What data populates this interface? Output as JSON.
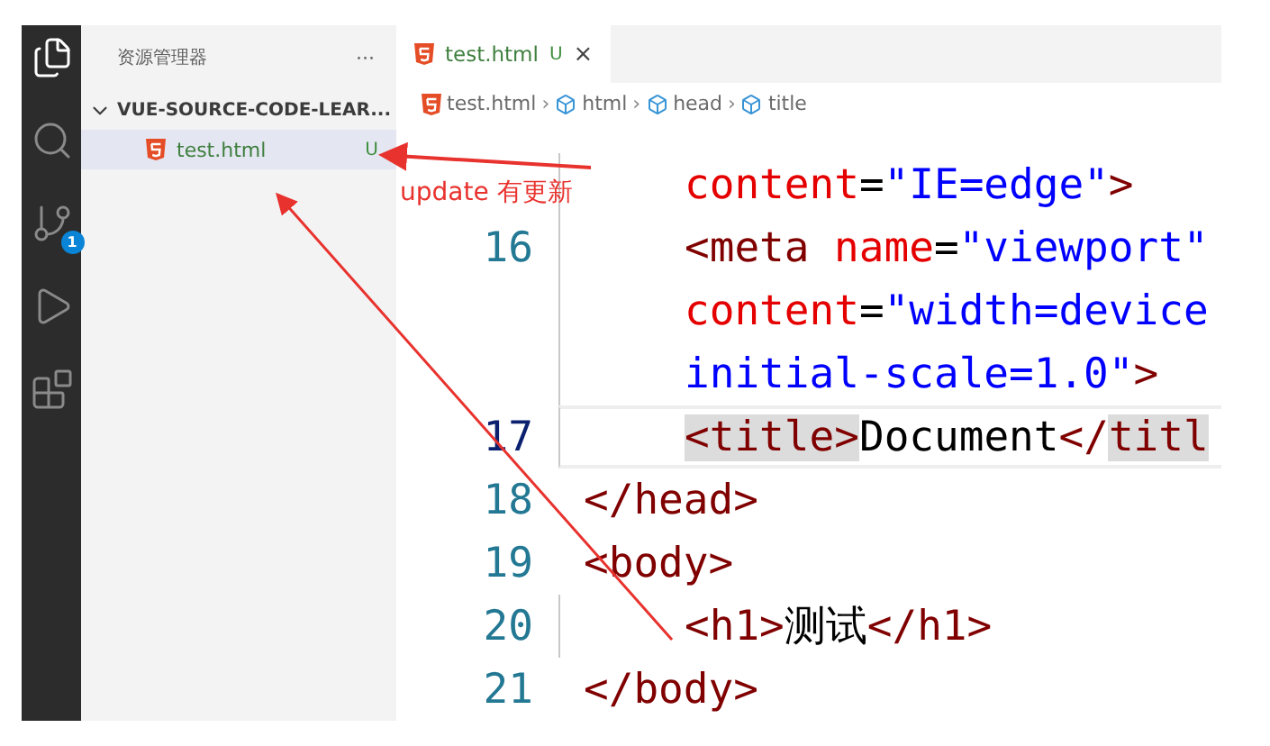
{
  "activity_bar": [
    {
      "kind": "explorer",
      "selected": true
    },
    {
      "kind": "search",
      "selected": false
    },
    {
      "kind": "source-control",
      "selected": false,
      "badge": "1"
    },
    {
      "kind": "run",
      "selected": false
    },
    {
      "kind": "extensions",
      "selected": false
    }
  ],
  "sidebar": {
    "title": "资源管理器",
    "more": "···",
    "folder": {
      "name": "VUE-SOURCE-CODE-LEAR...",
      "expanded": true
    },
    "files": [
      {
        "name": "test.html",
        "status": "U",
        "selected": true
      }
    ]
  },
  "tabs": [
    {
      "label": "test.html",
      "status": "U",
      "close": "×",
      "selected": true
    }
  ],
  "breadcrumbs": [
    {
      "kind": "file",
      "label": "test.html"
    },
    {
      "kind": "symbol",
      "label": "html",
      "separator": "›"
    },
    {
      "kind": "symbol",
      "label": "head",
      "separator": "›"
    },
    {
      "kind": "symbol",
      "label": "title",
      "separator": "›"
    }
  ],
  "code": [
    {
      "current": false,
      "guide": true,
      "indented": true,
      "tokens": [
        {
          "kind": "attr",
          "text": "content"
        },
        {
          "kind": "punct",
          "text": "="
        },
        {
          "kind": "value",
          "text": "\"IE=edge\""
        },
        {
          "kind": "tag",
          "text": ">"
        }
      ]
    },
    {
      "number": "16",
      "current": false,
      "guide": true,
      "indented": true,
      "tokens": [
        {
          "kind": "tag",
          "text": "<meta"
        },
        {
          "kind": "attr",
          "text": "name",
          "gap": true
        },
        {
          "kind": "punct",
          "text": "="
        },
        {
          "kind": "value",
          "text": "\"viewport\""
        }
      ]
    },
    {
      "current": false,
      "guide": true,
      "indented": true,
      "tokens": [
        {
          "kind": "attr",
          "text": "content"
        },
        {
          "kind": "punct",
          "text": "="
        },
        {
          "kind": "value",
          "text": "\"width=device"
        }
      ]
    },
    {
      "current": false,
      "guide": true,
      "indented": true,
      "tokens": [
        {
          "kind": "value",
          "text": "initial-scale=1.0\""
        },
        {
          "kind": "tag",
          "text": ">"
        }
      ]
    },
    {
      "number": "17",
      "current": true,
      "guide": true,
      "indented": true,
      "tokens": [
        {
          "kind": "tag",
          "text": "<",
          "match": true
        },
        {
          "kind": "tag",
          "text": "title",
          "match": true
        },
        {
          "kind": "tag",
          "text": ">",
          "match": true
        },
        {
          "kind": "text",
          "text": "Document"
        },
        {
          "kind": "tag",
          "text": "</",
          "match": false
        },
        {
          "kind": "tag",
          "text": "titl",
          "match": true
        }
      ]
    },
    {
      "number": "18",
      "current": false,
      "guide": false,
      "indented": false,
      "tokens": [
        {
          "kind": "tag",
          "text": "</head>"
        }
      ]
    },
    {
      "number": "19",
      "current": false,
      "guide": false,
      "indented": false,
      "tokens": [
        {
          "kind": "tag",
          "text": "<body>"
        }
      ]
    },
    {
      "number": "20",
      "current": false,
      "guide": true,
      "indented": true,
      "tokens": [
        {
          "kind": "tag",
          "text": "<h1>"
        },
        {
          "kind": "text",
          "text": "测试"
        },
        {
          "kind": "tag",
          "text": "</h1>"
        }
      ]
    },
    {
      "number": "21",
      "current": false,
      "guide": false,
      "indented": false,
      "tokens": [
        {
          "kind": "tag",
          "text": "</body>"
        }
      ]
    }
  ],
  "annotation": {
    "text": "update 有更新"
  }
}
